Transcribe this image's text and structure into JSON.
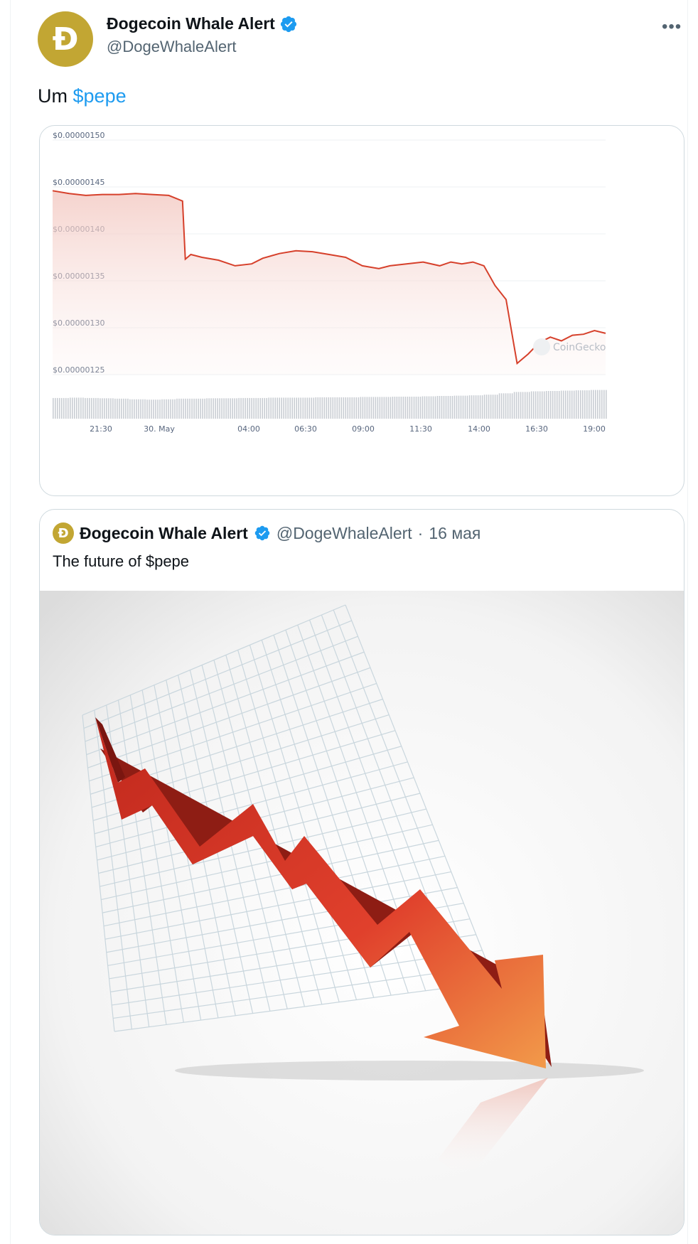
{
  "tweet": {
    "avatar_letter": "Ð",
    "display_name": "Ðogecoin Whale Alert",
    "handle": "@DogeWhaleAlert",
    "more_label": "•••",
    "text_prefix": "Um",
    "cashtag": "$pepe"
  },
  "chart_data": {
    "type": "area",
    "watermark": "CoinGecko",
    "y_ticks": [
      "$0.00000150",
      "$0.00000145",
      "$0.00000140",
      "$0.00000135",
      "$0.00000130",
      "$0.00000125"
    ],
    "x_ticks": [
      "21:30",
      "30. May",
      "04:00",
      "06:30",
      "09:00",
      "11:30",
      "14:00",
      "16:30",
      "19:00"
    ],
    "ylim": [
      1.25e-06,
      1.5e-06
    ],
    "x": [
      0,
      0.03,
      0.06,
      0.09,
      0.12,
      0.15,
      0.18,
      0.21,
      0.235,
      0.24,
      0.25,
      0.27,
      0.3,
      0.33,
      0.36,
      0.38,
      0.41,
      0.44,
      0.47,
      0.5,
      0.53,
      0.56,
      0.59,
      0.61,
      0.64,
      0.67,
      0.7,
      0.72,
      0.74,
      0.76,
      0.78,
      0.8,
      0.82,
      0.84,
      0.86,
      0.88,
      0.9,
      0.92,
      0.94,
      0.96,
      0.98,
      1.0
    ],
    "values": [
      1.446e-06,
      1.443e-06,
      1.441e-06,
      1.442e-06,
      1.442e-06,
      1.443e-06,
      1.442e-06,
      1.441e-06,
      1.435e-06,
      1.373e-06,
      1.378e-06,
      1.375e-06,
      1.372e-06,
      1.366e-06,
      1.368e-06,
      1.374e-06,
      1.379e-06,
      1.382e-06,
      1.381e-06,
      1.378e-06,
      1.375e-06,
      1.366e-06,
      1.363e-06,
      1.366e-06,
      1.368e-06,
      1.37e-06,
      1.366e-06,
      1.37e-06,
      1.368e-06,
      1.37e-06,
      1.366e-06,
      1.345e-06,
      1.33e-06,
      1.262e-06,
      1.272e-06,
      1.284e-06,
      1.29e-06,
      1.286e-06,
      1.292e-06,
      1.293e-06,
      1.297e-06,
      1.294e-06
    ],
    "volume": [
      0.62,
      0.63,
      0.62,
      0.61,
      0.6,
      0.58,
      0.57,
      0.58,
      0.6,
      0.6,
      0.61,
      0.61,
      0.62,
      0.62,
      0.63,
      0.63,
      0.63,
      0.64,
      0.64,
      0.64,
      0.65,
      0.65,
      0.66,
      0.66,
      0.67,
      0.68,
      0.69,
      0.7,
      0.72,
      0.76,
      0.8,
      0.82,
      0.83,
      0.84,
      0.85,
      0.86
    ],
    "line_color": "#d6402b",
    "fill_color": "#f7d7d2"
  },
  "quote": {
    "avatar_letter": "Ð",
    "display_name": "Ðogecoin Whale Alert",
    "handle": "@DogeWhaleAlert",
    "separator": "·",
    "date": "16 мая",
    "text": "The future of $pepe",
    "image_alt": "down-trend-arrow-chart"
  },
  "colors": {
    "accent": "#1d9bf0",
    "doge_gold": "#c2a633",
    "arrow_red": "#d93b2b"
  }
}
